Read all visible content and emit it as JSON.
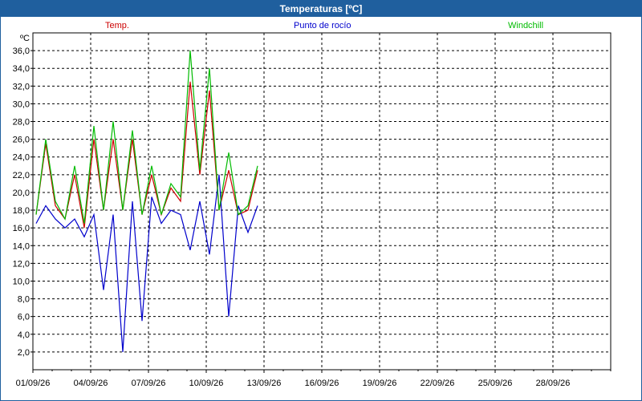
{
  "window": {
    "title": "Temperaturas [ºC]"
  },
  "colors": {
    "temp": "#cc0000",
    "dew": "#0000cc",
    "windchill": "#00bb00",
    "grid": "#000000",
    "title_bar": "#1f5f9e"
  },
  "chart_data": {
    "type": "line",
    "title": "Temperaturas [ºC]",
    "ylabel": "ºC",
    "xlabel": "",
    "grid": true,
    "legend_position": "top",
    "ylim": [
      0,
      38
    ],
    "xlim": [
      "01/09/26",
      "31/09/26"
    ],
    "x_tick_labels": [
      "01/09/26",
      "04/09/26",
      "07/09/26",
      "10/09/26",
      "13/09/26",
      "16/09/26",
      "19/09/26",
      "22/09/26",
      "25/09/26",
      "28/09/26"
    ],
    "y_tick_labels": [
      "2,0",
      "4,0",
      "6,0",
      "8,0",
      "10,0",
      "12,0",
      "14,0",
      "16,0",
      "18,0",
      "20,0",
      "22,0",
      "24,0",
      "26,0",
      "28,0",
      "30,0",
      "32,0",
      "34,0",
      "36,0"
    ],
    "x": [
      "01/09",
      "01/09 12h",
      "02/09",
      "02/09 12h",
      "03/09",
      "03/09 12h",
      "04/09",
      "04/09 12h",
      "05/09",
      "05/09 12h",
      "06/09",
      "06/09 12h",
      "07/09",
      "07/09 12h",
      "08/09",
      "08/09 12h",
      "09/09",
      "09/09 12h",
      "10/09",
      "10/09 12h",
      "11/09",
      "11/09 12h",
      "12/09",
      "12/09 12h"
    ],
    "series": [
      {
        "name": "Temp.",
        "color": "#cc0000",
        "values": [
          17.5,
          25.5,
          18.5,
          17.0,
          22.0,
          16.0,
          26.0,
          18.0,
          26.0,
          18.0,
          26.0,
          17.5,
          22.0,
          17.5,
          20.5,
          19.0,
          32.5,
          22.0,
          31.5,
          18.0,
          22.5,
          17.5,
          18.0,
          22.5
        ]
      },
      {
        "name": "Punto de rocío",
        "color": "#0000cc",
        "values": [
          16.5,
          18.5,
          17.0,
          16.0,
          17.0,
          15.0,
          17.5,
          9.0,
          17.5,
          2.0,
          19.0,
          5.5,
          19.5,
          16.5,
          18.0,
          17.5,
          13.5,
          19.0,
          13.0,
          22.0,
          6.0,
          18.5,
          15.5,
          18.5
        ]
      },
      {
        "name": "Windchill",
        "color": "#00bb00",
        "values": [
          17.5,
          26.0,
          19.0,
          17.0,
          23.0,
          16.5,
          27.5,
          18.0,
          28.0,
          18.0,
          27.0,
          17.5,
          23.0,
          17.5,
          21.0,
          19.5,
          36.0,
          22.5,
          34.0,
          18.0,
          24.5,
          17.5,
          18.5,
          23.0
        ]
      }
    ]
  }
}
